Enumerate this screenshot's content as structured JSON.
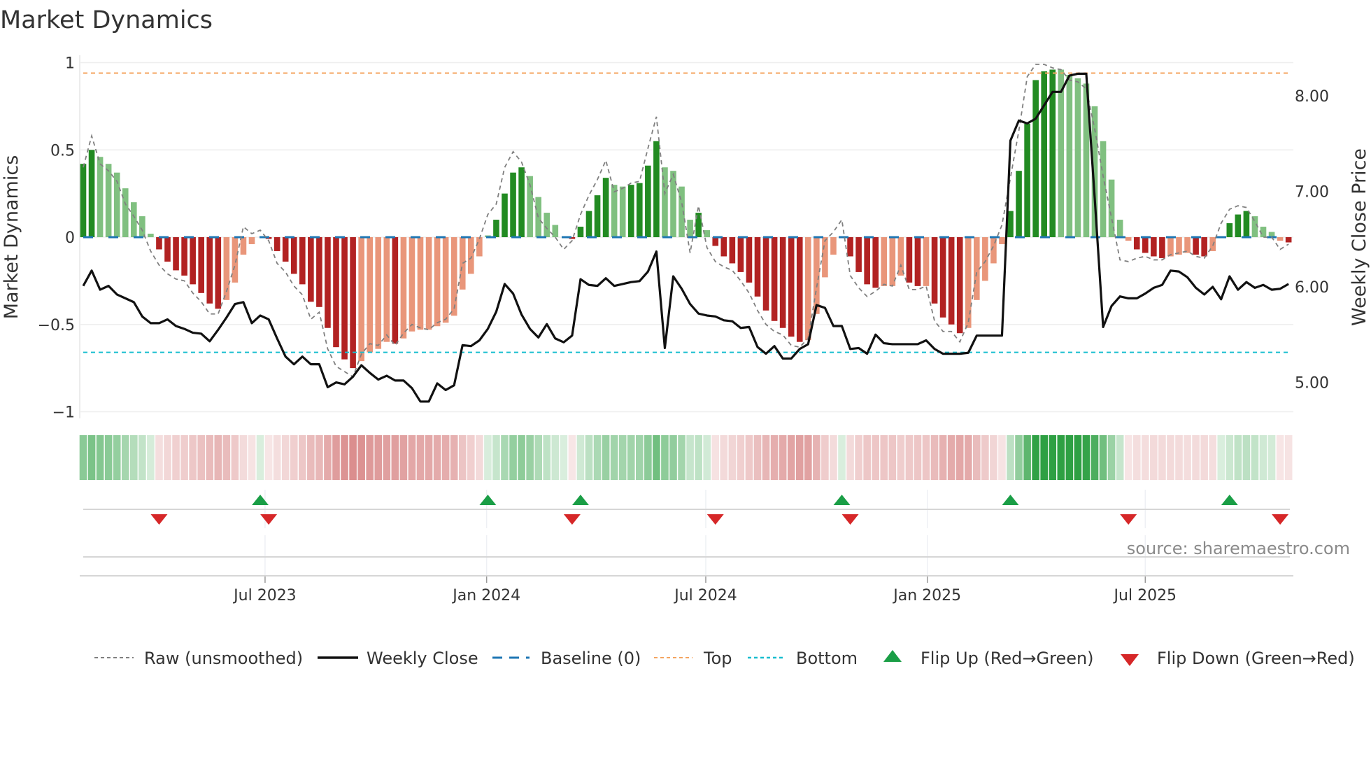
{
  "chart_data": {
    "type": "bar",
    "title": "Market Dynamics",
    "ylabel": "Market Dynamics",
    "ylabel_right": "Weekly Close Price",
    "ylim": [
      -1,
      1
    ],
    "ylim_right": [
      4.69,
      8.34
    ],
    "yticks": [
      {
        "v": 1,
        "label": "1"
      },
      {
        "v": 0.5,
        "label": "0.5"
      },
      {
        "v": 0,
        "label": "0"
      },
      {
        "v": -0.5,
        "label": "−0.5"
      },
      {
        "v": -1,
        "label": "−1"
      }
    ],
    "yticks_right": [
      {
        "v": 8,
        "label": "8.00"
      },
      {
        "v": 7,
        "label": "7.00"
      },
      {
        "v": 6,
        "label": "6.00"
      },
      {
        "v": 5,
        "label": "5.00"
      }
    ],
    "xticks": [
      {
        "date": "2023-07-01",
        "label": "Jul 2023"
      },
      {
        "date": "2024-01-01",
        "label": "Jan 2024"
      },
      {
        "date": "2024-07-01",
        "label": "Jul 2024"
      },
      {
        "date": "2025-01-01",
        "label": "Jan 2025"
      },
      {
        "date": "2025-07-01",
        "label": "Jul 2025"
      }
    ],
    "start_date": "2023-01-31",
    "frequency": "weekly",
    "top_level": 0.94,
    "bottom_level": -0.66,
    "baseline": 0,
    "values": [
      0.42,
      0.5,
      0.46,
      0.42,
      0.37,
      0.28,
      0.2,
      0.12,
      0.02,
      -0.07,
      -0.14,
      -0.19,
      -0.22,
      -0.27,
      -0.32,
      -0.38,
      -0.41,
      -0.36,
      -0.26,
      -0.1,
      -0.04,
      0,
      -0.01,
      -0.08,
      -0.14,
      -0.21,
      -0.27,
      -0.37,
      -0.4,
      -0.52,
      -0.63,
      -0.7,
      -0.75,
      -0.71,
      -0.66,
      -0.64,
      -0.6,
      -0.61,
      -0.58,
      -0.54,
      -0.53,
      -0.53,
      -0.51,
      -0.49,
      -0.45,
      -0.3,
      -0.21,
      -0.11,
      0.01,
      0.1,
      0.25,
      0.37,
      0.4,
      0.35,
      0.23,
      0.14,
      0.07,
      0,
      -0.01,
      0.06,
      0.15,
      0.24,
      0.34,
      0.3,
      0.29,
      0.3,
      0.31,
      0.41,
      0.55,
      0.4,
      0.38,
      0.29,
      0.1,
      0.14,
      0.04,
      -0.05,
      -0.11,
      -0.15,
      -0.2,
      -0.26,
      -0.34,
      -0.42,
      -0.48,
      -0.52,
      -0.57,
      -0.6,
      -0.59,
      -0.44,
      -0.23,
      -0.1,
      0,
      -0.11,
      -0.2,
      -0.27,
      -0.29,
      -0.28,
      -0.28,
      -0.22,
      -0.26,
      -0.28,
      -0.28,
      -0.38,
      -0.46,
      -0.5,
      -0.55,
      -0.52,
      -0.36,
      -0.25,
      -0.15,
      -0.04,
      0.15,
      0.38,
      0.65,
      0.9,
      0.95,
      0.96,
      0.96,
      0.93,
      0.91,
      0.88,
      0.75,
      0.55,
      0.33,
      0.1,
      -0.02,
      -0.07,
      -0.09,
      -0.11,
      -0.12,
      -0.11,
      -0.1,
      -0.09,
      -0.1,
      -0.11,
      -0.08,
      0,
      0.08,
      0.13,
      0.15,
      0.12,
      0.06,
      0.03,
      -0.02,
      -0.03
    ],
    "raw": [
      0.4,
      0.58,
      0.42,
      0.38,
      0.32,
      0.19,
      0.12,
      0.04,
      -0.08,
      -0.16,
      -0.21,
      -0.24,
      -0.25,
      -0.32,
      -0.37,
      -0.44,
      -0.44,
      -0.31,
      -0.16,
      0.06,
      0.02,
      0.04,
      -0.02,
      -0.15,
      -0.2,
      -0.28,
      -0.33,
      -0.47,
      -0.43,
      -0.64,
      -0.74,
      -0.77,
      -0.8,
      -0.67,
      -0.61,
      -0.62,
      -0.56,
      -0.62,
      -0.55,
      -0.5,
      -0.52,
      -0.53,
      -0.49,
      -0.47,
      -0.41,
      -0.15,
      -0.12,
      -0.01,
      0.13,
      0.19,
      0.4,
      0.49,
      0.43,
      0.3,
      0.11,
      0.05,
      0.0,
      -0.07,
      -0.02,
      0.13,
      0.24,
      0.33,
      0.44,
      0.26,
      0.28,
      0.31,
      0.32,
      0.51,
      0.69,
      0.25,
      0.36,
      0.2,
      -0.09,
      0.18,
      -0.06,
      -0.14,
      -0.17,
      -0.19,
      -0.25,
      -0.32,
      -0.42,
      -0.5,
      -0.54,
      -0.56,
      -0.62,
      -0.63,
      -0.58,
      -0.29,
      -0.02,
      0.03,
      0.1,
      -0.22,
      -0.29,
      -0.34,
      -0.31,
      -0.27,
      -0.28,
      -0.16,
      -0.3,
      -0.3,
      -0.28,
      -0.48,
      -0.54,
      -0.54,
      -0.6,
      -0.49,
      -0.2,
      -0.14,
      -0.05,
      0.07,
      0.34,
      0.61,
      0.92,
      0.99,
      0.99,
      0.97,
      0.96,
      0.9,
      0.89,
      0.85,
      0.62,
      0.35,
      0.11,
      -0.13,
      -0.14,
      -0.12,
      -0.11,
      -0.13,
      -0.13,
      -0.1,
      -0.09,
      -0.08,
      -0.11,
      -0.12,
      -0.05,
      0.08,
      0.16,
      0.18,
      0.17,
      0.09,
      0.0,
      0.0,
      -0.07,
      -0.04
    ],
    "close": [
      6.01,
      6.17,
      5.97,
      6.01,
      5.92,
      5.88,
      5.84,
      5.69,
      5.62,
      5.62,
      5.66,
      5.59,
      5.56,
      5.52,
      5.51,
      5.43,
      5.55,
      5.68,
      5.82,
      5.84,
      5.62,
      5.7,
      5.66,
      5.46,
      5.27,
      5.19,
      5.27,
      5.19,
      5.19,
      4.95,
      5.0,
      4.98,
      5.06,
      5.18,
      5.1,
      5.03,
      5.07,
      5.02,
      5.02,
      4.94,
      4.8,
      4.8,
      4.99,
      4.92,
      4.97,
      5.39,
      5.38,
      5.44,
      5.56,
      5.74,
      6.03,
      5.93,
      5.71,
      5.56,
      5.47,
      5.61,
      5.46,
      5.42,
      5.49,
      6.08,
      6.02,
      6.01,
      6.09,
      6.01,
      6.03,
      6.05,
      6.06,
      6.16,
      6.37,
      5.36,
      6.11,
      5.98,
      5.82,
      5.72,
      5.7,
      5.69,
      5.65,
      5.64,
      5.57,
      5.58,
      5.37,
      5.3,
      5.38,
      5.25,
      5.25,
      5.35,
      5.4,
      5.81,
      5.78,
      5.59,
      5.59,
      5.35,
      5.36,
      5.3,
      5.5,
      5.41,
      5.4,
      5.4,
      5.4,
      5.4,
      5.44,
      5.35,
      5.3,
      5.3,
      5.3,
      5.31,
      5.49,
      5.49,
      5.49,
      5.49,
      7.53,
      7.74,
      7.71,
      7.76,
      7.9,
      8.04,
      8.04,
      8.21,
      8.23,
      8.23,
      6.93,
      5.58,
      5.8,
      5.9,
      5.88,
      5.88,
      5.93,
      5.99,
      6.02,
      6.17,
      6.16,
      6.1,
      5.99,
      5.92,
      6.0,
      5.87,
      6.11,
      5.97,
      6.05,
      5.99,
      6.02,
      5.97,
      5.98,
      6.03
    ],
    "flip_up_dates": [
      "2023-06-27",
      "2024-01-02",
      "2024-03-19",
      "2024-10-22",
      "2025-03-11",
      "2025-09-09"
    ],
    "flip_down_dates": [
      "2023-04-04",
      "2023-07-04",
      "2024-03-12",
      "2024-07-09",
      "2024-10-29",
      "2025-06-17",
      "2025-10-21"
    ],
    "legend": {
      "placement": "bottom",
      "raw": "Raw (unsmoothed)",
      "close": "Weekly Close",
      "baseline": "Baseline (0)",
      "top": "Top",
      "bottom": "Bottom",
      "flip_up": "Flip Up (Red→Green)",
      "flip_down": "Flip Down (Green→Red)"
    },
    "source": "source: sharemaestro.com",
    "colors": {
      "green_strong": "#228b22",
      "green_light": "#80c080",
      "red_strong": "#b22222",
      "red_light": "#e9967a",
      "baseline": "#1f77b4",
      "top": "#f4a460",
      "bottom": "#17becf",
      "close": "#111111",
      "raw": "#808080",
      "flip_up": "#1a9e46",
      "flip_down": "#d62728"
    }
  }
}
